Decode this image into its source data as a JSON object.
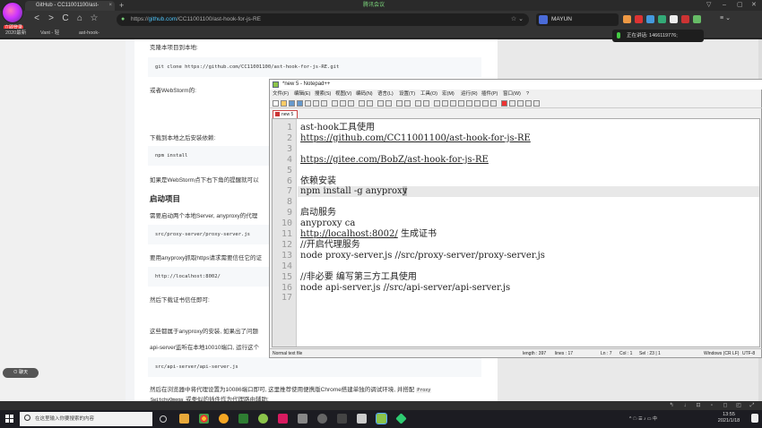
{
  "browser": {
    "tab_title": "GitHub - CC11001100/ast-",
    "tab_close": "×",
    "new_tab": "+",
    "meeting_label": "腾讯会议",
    "window_controls": [
      "▽",
      "–",
      "▢",
      "✕"
    ],
    "avatar_badge": "立即登录",
    "nav": {
      "back": "<",
      "forward": ">",
      "reload": "C",
      "home": "⌂",
      "bookmark": "☆"
    },
    "url_prefix": "https://",
    "url_host": "github.com",
    "url_path": "/CC11001100/ast-hook-for-js-RE",
    "url_star": "☆ ⌄",
    "profile_name": "MAYUN",
    "menu_glyph": "≡ ⌄",
    "bookmarks": [
      "2020最新",
      "Vant - 轻",
      "ast-hook-"
    ]
  },
  "meeting": {
    "speaking_label": "正在讲话: 1466119776;"
  },
  "article": {
    "clone_intro": "克隆本项目到本地:",
    "clone_cmd": "git clone https://github.com/CC11001100/ast-hook-for-js-RE.git",
    "webstorm_text": "或者WebStorm的:",
    "install_intro": "下载到本地之后安装依赖:",
    "install_cmd": "npm install",
    "webstorm_hint": "如果是WebStorm点下右下角的提醒就可以",
    "start_heading": "启动项目",
    "start_desc": "需要启动两个本地Server, anyproxy的代理",
    "proxy_server_cmd": "src/proxy-server/proxy-server.js",
    "https_desc": "要用anyproxy抓取https请求需要信任它的证",
    "localhost_url": "http://localhost:8002/",
    "download_cert": "然后下载证书信任即可:",
    "anyproxy_note": "这些都属于anyproxy的安装, 如果出了问题",
    "api_server_desc": "api-server监听在本地10010端口, 运行这个",
    "api_server_cmd": "src/api-server/api-server.js",
    "browser_proxy_text": "然后在浏览器中将代理设置为10086端口即可, 这里推荐使用便携版Chrome搭建单独的调试环境, 并搭配",
    "proxy_code": "Proxy",
    "switchy_code": "SwitchyOmega",
    "switchy_text": "或类似的插件作为代理路由辅助:"
  },
  "chat_pill": "⊙ 聊天",
  "bottom_toolbar": [
    "↰",
    "↓",
    "⊡",
    "▫",
    "◻",
    "◰",
    "⤢"
  ],
  "notepad": {
    "title": "*new 5 - Notepad++",
    "menu": [
      "文件(F)",
      "编辑(E)",
      "搜索(S)",
      "视图(V)",
      "编码(N)",
      "语言(L)",
      "设置(T)",
      "工具(O)",
      "宏(M)",
      "运行(R)",
      "插件(P)",
      "窗口(W)",
      "?"
    ],
    "tab": "new 5",
    "lines": [
      {
        "n": "1",
        "text": "ast-hook工具使用"
      },
      {
        "n": "2",
        "text": "https://github.com/CC11001100/ast-hook-for-js-RE"
      },
      {
        "n": "3",
        "text": ""
      },
      {
        "n": "4",
        "text": "https://gitee.com/BobZ/ast-hook-for-js-RE"
      },
      {
        "n": "5",
        "text": ""
      },
      {
        "n": "6",
        "text": "依赖安装"
      },
      {
        "n": "7",
        "text_before": "npm install -g anyprox",
        "text_sel": "y"
      },
      {
        "n": "8",
        "text": ""
      },
      {
        "n": "9",
        "text": "启动服务"
      },
      {
        "n": "10",
        "text": "anyproxy ca"
      },
      {
        "n": "11",
        "link": "http://localhost:8002/",
        "text": " 生成证书"
      },
      {
        "n": "12",
        "text": "//开启代理服务"
      },
      {
        "n": "13",
        "text": "node proxy-server.js //src/proxy-server/proxy-server.js"
      },
      {
        "n": "14",
        "text": ""
      },
      {
        "n": "15",
        "text": "//非必要 编写第三方工具使用"
      },
      {
        "n": "16",
        "text": "node api-server.js //src/api-server/api-server.js"
      },
      {
        "n": "17",
        "text": ""
      }
    ],
    "status": {
      "type": "Normal text file",
      "length": "length : 397",
      "lines": "lines : 17",
      "ln": "Ln : 7",
      "col": "Col : 1",
      "sel": "Sel : 23 | 1",
      "eol": "Windows (CR LF)",
      "encoding": "UTF-8"
    }
  },
  "taskbar": {
    "search_placeholder": "在这里输入你要搜索的内容",
    "tray_text": "^ ☁ ☰ ♪ ▭ 中",
    "time": "13:55",
    "date": "2021/1/18"
  }
}
